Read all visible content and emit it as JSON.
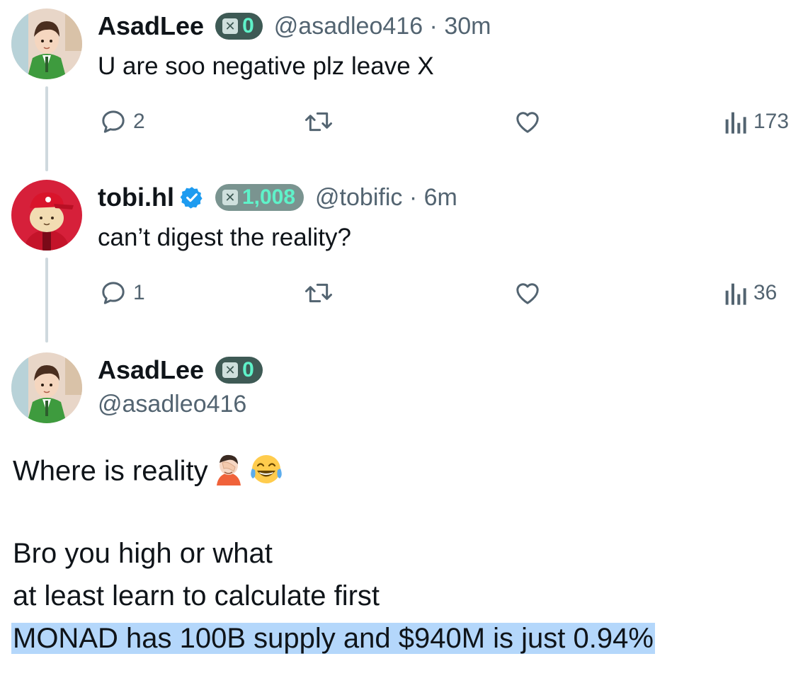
{
  "reply1": {
    "display_name": "AsadLee",
    "score": "0",
    "handle_time": "@asadleo416 · 30m",
    "text": "U are soo negative plz leave X",
    "replies": "2",
    "views": "173"
  },
  "reply2": {
    "display_name": "tobi.hl",
    "score": "1,008",
    "handle_time": "@tobific · 6m",
    "text": "can’t digest the reality?",
    "replies": "1",
    "views": "36"
  },
  "main": {
    "display_name": "AsadLee",
    "score": "0",
    "handle": "@asadleo416",
    "line1": "Where is reality",
    "line2": "Bro you high or what",
    "line3": "at least learn to calculate first",
    "line4": "MONAD has 100B supply and $940M is just 0.94%"
  },
  "icons": {
    "reply": "reply-icon",
    "retweet": "retweet-icon",
    "like": "heart-icon",
    "views": "views-icon",
    "verified": "verified-badge-icon",
    "facepalm": "facepalm-emoji",
    "laugh": "tears-of-joy-emoji"
  },
  "colors": {
    "text": "#0f1419",
    "secondary": "#536471",
    "badge_bg": "#3e5a55",
    "badge_value": "#5ff2c9",
    "verified": "#1d9bf0",
    "highlight": "#b4d7fb"
  }
}
